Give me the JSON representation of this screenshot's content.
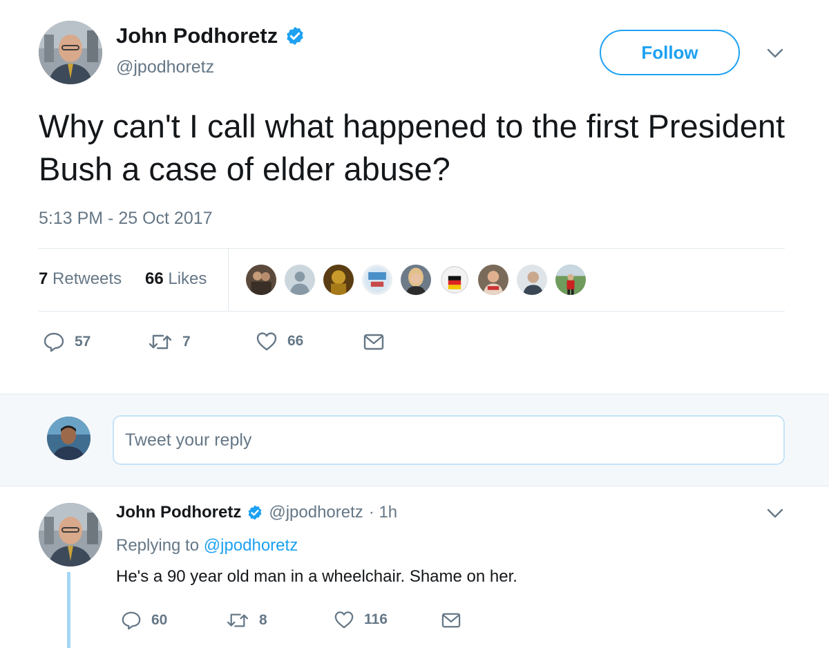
{
  "tweet": {
    "author_name": "John Podhoretz",
    "author_handle": "@jpodhoretz",
    "verified_icon": "verified-badge-icon",
    "follow_label": "Follow",
    "menu_icon": "chevron-down-icon",
    "text": "Why can't I call what happened to the first President Bush a case of elder abuse?",
    "timestamp": "5:13 PM - 25 Oct 2017",
    "stats": {
      "retweets_count": "7",
      "retweets_label": "Retweets",
      "likes_count": "66",
      "likes_label": "Likes"
    },
    "likers_count": 9,
    "actions": {
      "reply_count": "57",
      "retweet_count": "7",
      "like_count": "66",
      "reply_icon": "reply-icon",
      "retweet_icon": "retweet-icon",
      "like_icon": "heart-icon",
      "message_icon": "envelope-icon"
    }
  },
  "reply_box": {
    "placeholder": "Tweet your reply"
  },
  "reply_tweet": {
    "author_name": "John Podhoretz",
    "author_handle": "@jpodhoretz",
    "time": "· 1h",
    "replying_prefix": "Replying to",
    "replying_to": "@jpodhoretz",
    "text": "He's a 90 year old man in a wheelchair. Shame on her.",
    "actions": {
      "reply_count": "60",
      "retweet_count": "8",
      "like_count": "116"
    }
  },
  "colors": {
    "accent": "#1da1f2",
    "muted": "#657786",
    "text": "#14171a",
    "divider": "#e1e8ed",
    "reply_bar_bg": "#f5f8fa"
  }
}
